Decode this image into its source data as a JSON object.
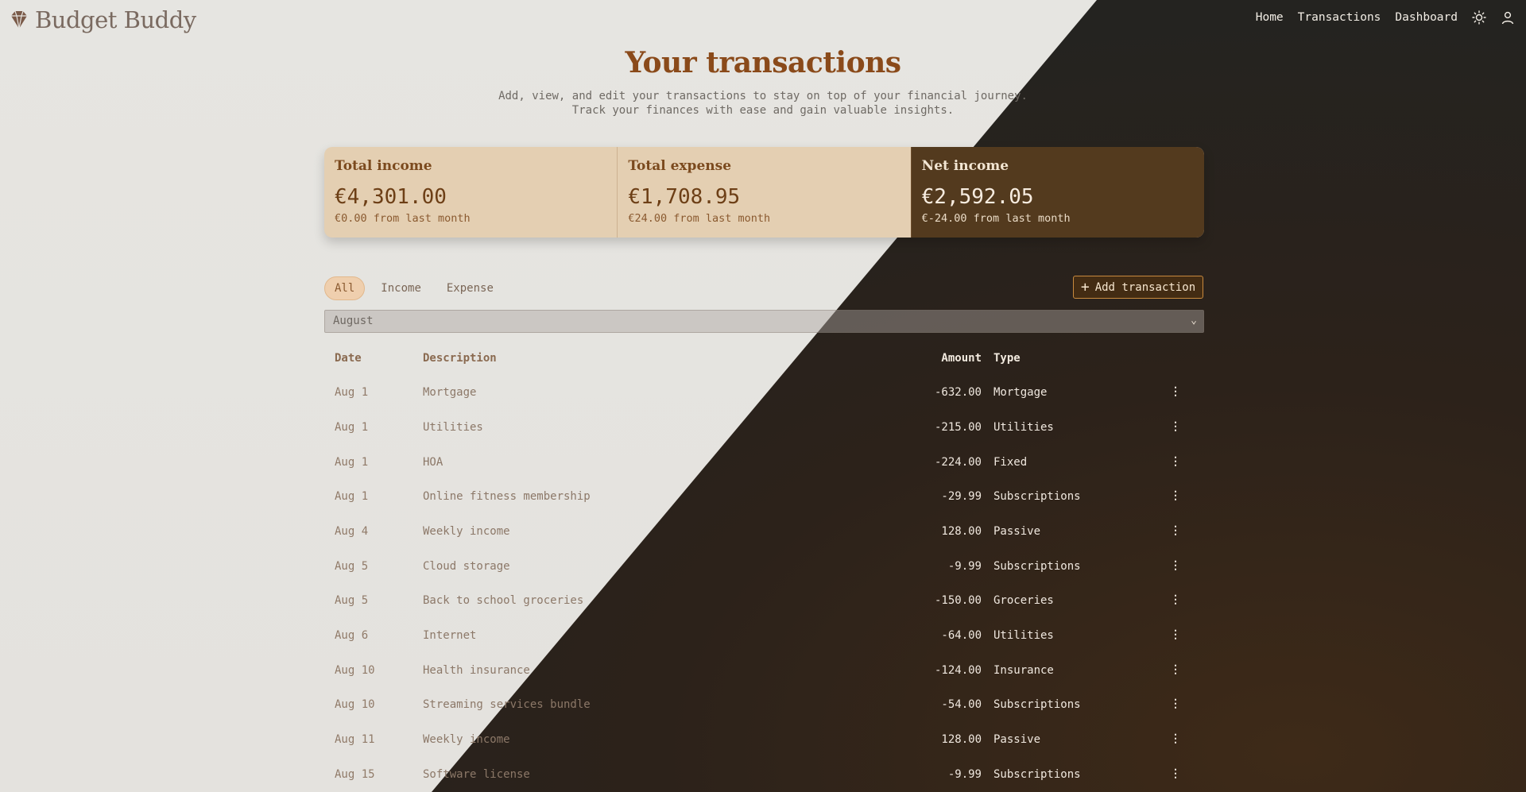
{
  "app": {
    "name": "Budget Buddy"
  },
  "nav": {
    "home": "Home",
    "transactions": "Transactions",
    "dashboard": "Dashboard"
  },
  "page": {
    "title": "Your transactions",
    "subtitle_line1": "Add, view, and edit your transactions to stay on top of your financial journey.",
    "subtitle_line2": "Track your finances with ease and gain valuable insights."
  },
  "stats": [
    {
      "label": "Total income",
      "value": "€4,301.00",
      "note": "€0.00 from last month"
    },
    {
      "label": "Total expense",
      "value": "€1,708.95",
      "note": "€24.00 from last month"
    },
    {
      "label": "Net income",
      "value": "€2,592.05",
      "note": "€-24.00 from last month"
    }
  ],
  "filters": {
    "all": "All",
    "income": "Income",
    "expense": "Expense",
    "active": "All"
  },
  "add_button": "Add transaction",
  "month_select": {
    "value": "August"
  },
  "table": {
    "headers": {
      "date": "Date",
      "description": "Description",
      "amount": "Amount",
      "type": "Type"
    },
    "rows": [
      {
        "date": "Aug 1",
        "description": "Mortgage",
        "amount": "-632.00",
        "type": "Mortgage"
      },
      {
        "date": "Aug 1",
        "description": "Utilities",
        "amount": "-215.00",
        "type": "Utilities"
      },
      {
        "date": "Aug 1",
        "description": "HOA",
        "amount": "-224.00",
        "type": "Fixed"
      },
      {
        "date": "Aug 1",
        "description": "Online fitness membership",
        "amount": "-29.99",
        "type": "Subscriptions"
      },
      {
        "date": "Aug 4",
        "description": "Weekly income",
        "amount": "128.00",
        "type": "Passive"
      },
      {
        "date": "Aug 5",
        "description": "Cloud storage",
        "amount": "-9.99",
        "type": "Subscriptions"
      },
      {
        "date": "Aug 5",
        "description": "Back to school groceries",
        "amount": "-150.00",
        "type": "Groceries"
      },
      {
        "date": "Aug 6",
        "description": "Internet",
        "amount": "-64.00",
        "type": "Utilities"
      },
      {
        "date": "Aug 10",
        "description": "Health insurance",
        "amount": "-124.00",
        "type": "Insurance"
      },
      {
        "date": "Aug 10",
        "description": "Streaming services bundle",
        "amount": "-54.00",
        "type": "Subscriptions"
      },
      {
        "date": "Aug 11",
        "description": "Weekly income",
        "amount": "128.00",
        "type": "Passive"
      },
      {
        "date": "Aug 15",
        "description": "Software license",
        "amount": "-9.99",
        "type": "Subscriptions"
      }
    ]
  },
  "icons": {
    "logo": "diamond-icon",
    "theme": "sun-icon",
    "user": "user-icon",
    "add": "plus-icon",
    "chevron": "chevron-down-icon",
    "menu": "more-vertical-icon"
  },
  "colors": {
    "accent": "#8a4a1a",
    "card": "#e4cfb2",
    "card_dark": "#533a1e"
  }
}
